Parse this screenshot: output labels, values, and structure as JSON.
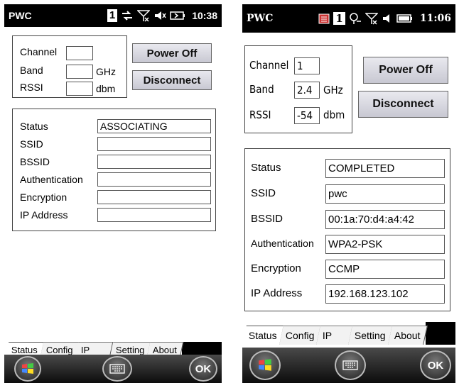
{
  "screens": [
    {
      "app_title": "PWC",
      "badge": "1",
      "clock": "10:38",
      "labels": {
        "channel": "Channel",
        "band": "Band",
        "rssi": "RSSI"
      },
      "units": {
        "band": "GHz",
        "rssi": "dbm"
      },
      "values": {
        "channel": "",
        "band": "",
        "rssi": ""
      },
      "buttons": {
        "power": "Power Off",
        "disconnect": "Disconnect"
      },
      "status_labels": [
        "Status",
        "SSID",
        "BSSID",
        "Authentication",
        "Encryption",
        "IP Address"
      ],
      "status_values": [
        "ASSOCIATING",
        "",
        "",
        "",
        "",
        ""
      ],
      "tabs": [
        "Status",
        "Config",
        "IP",
        "Setting",
        "About"
      ],
      "active_tab": "Status",
      "ok_label": "OK"
    },
    {
      "app_title": "PWC",
      "badge": "1",
      "clock": "11:06",
      "labels": {
        "channel": "Channel",
        "band": "Band",
        "rssi": "RSSI"
      },
      "units": {
        "band": "GHz",
        "rssi": "dbm"
      },
      "values": {
        "channel": "1",
        "band": "2.4",
        "rssi": "-54"
      },
      "buttons": {
        "power": "Power Off",
        "disconnect": "Disconnect"
      },
      "status_labels": [
        "Status",
        "SSID",
        "BSSID",
        "Authentication",
        "Encryption",
        "IP Address"
      ],
      "status_values": [
        "COMPLETED",
        "pwc",
        "00:1a:70:d4:a4:42",
        "WPA2-PSK",
        "CCMP",
        "192.168.123.102"
      ],
      "tabs": [
        "Status",
        "Config",
        "IP",
        "Setting",
        "About"
      ],
      "active_tab": "Status",
      "ok_label": "OK"
    }
  ],
  "icons": {
    "network": "network-activity-icon",
    "signal": "signal-strength-icon",
    "volume": "speaker-mute-icon",
    "battery": "battery-icon",
    "start": "windows-start-icon",
    "keyboard": "keyboard-icon"
  },
  "colors": {
    "titlebar": "#000000",
    "button_face": "#dcdce4",
    "softbar": "#1a1a1a"
  }
}
